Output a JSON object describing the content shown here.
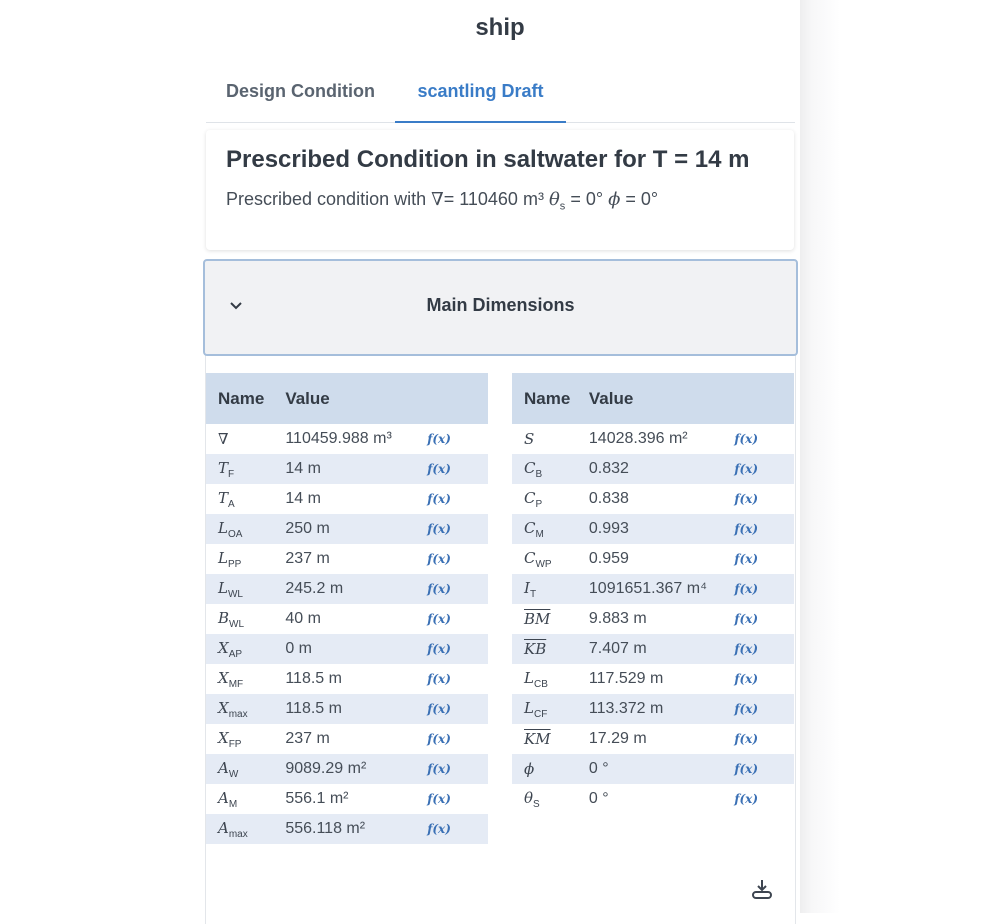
{
  "page": {
    "title": "ship"
  },
  "tabs": [
    {
      "label": "Design Condition",
      "active": false
    },
    {
      "label": "scantling Draft",
      "active": true
    }
  ],
  "condition": {
    "title": "Prescribed Condition in saltwater for T = 14 m",
    "subtitle_prefix": "Prescribed condition with",
    "volume_symbol": "∇",
    "volume": "= 110460 m³",
    "trim_symbol": "θ",
    "trim_sub": "s",
    "trim": "= 0°",
    "heel_symbol": "ϕ",
    "heel": "= 0°"
  },
  "accordion": {
    "title": "Main Dimensions",
    "icon": "chevron-down-icon",
    "expanded": true
  },
  "table_headers": {
    "name": "Name",
    "value": "Value"
  },
  "formula_label": "f(x)",
  "left_rows": [
    {
      "sym": "∇",
      "sub": "",
      "value": "110459.988 m³"
    },
    {
      "sym": "T",
      "sub": "F",
      "value": "14 m"
    },
    {
      "sym": "T",
      "sub": "A",
      "value": "14 m"
    },
    {
      "sym": "L",
      "sub": "OA",
      "value": "250 m"
    },
    {
      "sym": "L",
      "sub": "PP",
      "value": "237 m"
    },
    {
      "sym": "L",
      "sub": "WL",
      "value": "245.2 m"
    },
    {
      "sym": "B",
      "sub": "WL",
      "value": "40 m"
    },
    {
      "sym": "X",
      "sub": "AP",
      "value": "0 m"
    },
    {
      "sym": "X",
      "sub": "MF",
      "value": "118.5 m"
    },
    {
      "sym": "X",
      "sub": "max",
      "value": "118.5 m"
    },
    {
      "sym": "X",
      "sub": "FP",
      "value": "237 m"
    },
    {
      "sym": "A",
      "sub": "W",
      "value": "9089.29 m²"
    },
    {
      "sym": "A",
      "sub": "M",
      "value": "556.1 m²"
    },
    {
      "sym": "A",
      "sub": "max",
      "value": "556.118 m²"
    }
  ],
  "right_rows": [
    {
      "sym": "S",
      "sub": "",
      "value": "14028.396 m²"
    },
    {
      "sym": "C",
      "sub": "B",
      "value": "0.832"
    },
    {
      "sym": "C",
      "sub": "P",
      "value": "0.838"
    },
    {
      "sym": "C",
      "sub": "M",
      "value": "0.993"
    },
    {
      "sym": "C",
      "sub": "WP",
      "value": "0.959"
    },
    {
      "sym": "I",
      "sub": "T",
      "value": "1091651.367 m⁴"
    },
    {
      "sym": "BM",
      "sub": "",
      "over": true,
      "value": "9.883 m"
    },
    {
      "sym": "KB",
      "sub": "",
      "over": true,
      "value": "7.407 m"
    },
    {
      "sym": "L",
      "sub": "CB",
      "value": "117.529 m"
    },
    {
      "sym": "L",
      "sub": "CF",
      "value": "113.372 m"
    },
    {
      "sym": "KM",
      "sub": "",
      "over": true,
      "value": "17.29 m"
    },
    {
      "sym": "ϕ",
      "sub": "",
      "value": "0 °"
    },
    {
      "sym": "θ",
      "sub": "S",
      "value": "0 °"
    }
  ],
  "download": {
    "icon": "download-icon"
  }
}
